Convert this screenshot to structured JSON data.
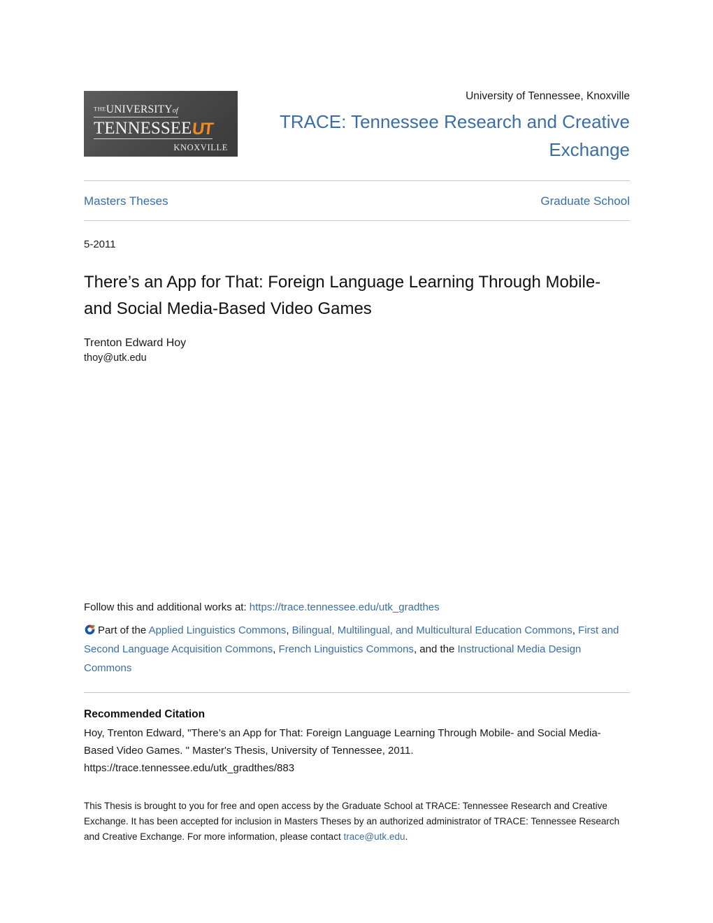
{
  "header": {
    "logo": {
      "the": "THE",
      "university": "UNIVERSITY",
      "of": "of",
      "tennessee": "TENNESSEE",
      "ut_mark": "UT",
      "knoxville": "KNOXVILLE"
    },
    "university_line": "University of Tennessee, Knoxville",
    "repository_title": "TRACE: Tennessee Research and Creative Exchange"
  },
  "nav": {
    "collection": "Masters Theses",
    "parent_unit": "Graduate School"
  },
  "record": {
    "date": "5-2011",
    "title": "There’s an App for That: Foreign Language Learning Through Mobile- and Social Media-Based Video Games",
    "author_name": "Trenton Edward Hoy",
    "author_email": "thoy@utk.edu"
  },
  "follow": {
    "prefix": "Follow this and additional works at:",
    "url": "https://trace.tennessee.edu/utk_gradthes",
    "icon": "digital-commons-network-icon",
    "part_of_label": "Part of the",
    "commons": [
      "Applied Linguistics Commons",
      "Bilingual, Multilingual, and Multicultural Education Commons",
      "First and Second Language Acquisition Commons",
      "French Linguistics Commons",
      "Instructional Media Design Commons"
    ],
    "separator": ", ",
    "and_the": ", and the "
  },
  "citation": {
    "heading": "Recommended Citation",
    "text": "Hoy, Trenton Edward, \"There’s an App for That: Foreign Language Learning Through Mobile- and Social Media-Based Video Games. \" Master's Thesis, University of Tennessee, 2011.",
    "url": "https://trace.tennessee.edu/utk_gradthes/883"
  },
  "footer": {
    "text_before_email": "This Thesis is brought to you for free and open access by the Graduate School at TRACE: Tennessee Research and Creative Exchange. It has been accepted for inclusion in Masters Theses by an authorized administrator of TRACE: Tennessee Research and Creative Exchange. For more information, please contact ",
    "contact_email": "trace@utk.edu",
    "text_after_email": "."
  },
  "colors": {
    "link_blue": "#3a6ea5",
    "rule_gray": "#c9c9c9",
    "ut_orange": "#f28b1e",
    "logo_dark": "#4a4a4a"
  }
}
